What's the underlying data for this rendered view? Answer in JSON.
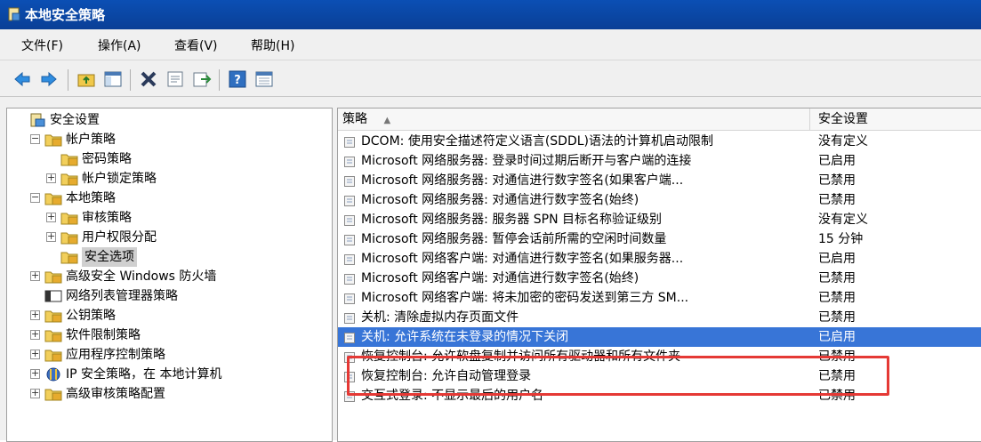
{
  "window": {
    "title": "本地安全策略"
  },
  "menu": [
    "文件(F)",
    "操作(A)",
    "查看(V)",
    "帮助(H)"
  ],
  "toolbar": {
    "buttons": [
      "back-icon",
      "forward-icon",
      "up-folder-icon",
      "show-hide-tree-icon",
      "delete-icon",
      "properties-icon",
      "export-list-icon",
      "help-icon",
      "mmc-icon"
    ]
  },
  "tree": {
    "items": [
      {
        "label": "安全设置",
        "level": 0,
        "expander": "",
        "icon": "security-settings-icon"
      },
      {
        "label": "帐户策略",
        "level": 1,
        "expander": "−",
        "icon": "folder-icon"
      },
      {
        "label": "密码策略",
        "level": 2,
        "expander": "",
        "icon": "folder-icon"
      },
      {
        "label": "帐户锁定策略",
        "level": 2,
        "expander": "+",
        "icon": "folder-icon"
      },
      {
        "label": "本地策略",
        "level": 1,
        "expander": "−",
        "icon": "folder-icon"
      },
      {
        "label": "审核策略",
        "level": 2,
        "expander": "+",
        "icon": "folder-icon"
      },
      {
        "label": "用户权限分配",
        "level": 2,
        "expander": "+",
        "icon": "folder-icon"
      },
      {
        "label": "安全选项",
        "level": 2,
        "expander": "",
        "icon": "folder-icon",
        "selected": true
      },
      {
        "label": "高级安全 Windows 防火墙",
        "level": 1,
        "expander": "+",
        "icon": "folder-icon"
      },
      {
        "label": "网络列表管理器策略",
        "level": 1,
        "expander": "",
        "icon": "network-list-icon"
      },
      {
        "label": "公钥策略",
        "level": 1,
        "expander": "+",
        "icon": "folder-icon"
      },
      {
        "label": "软件限制策略",
        "level": 1,
        "expander": "+",
        "icon": "folder-icon"
      },
      {
        "label": "应用程序控制策略",
        "level": 1,
        "expander": "+",
        "icon": "folder-icon"
      },
      {
        "label": "IP 安全策略，在 本地计算机",
        "level": 1,
        "expander": "+",
        "icon": "ip-security-icon"
      },
      {
        "label": "高级审核策略配置",
        "level": 1,
        "expander": "+",
        "icon": "folder-icon"
      }
    ]
  },
  "list": {
    "columns": {
      "policy": "策略",
      "sort_glyph": "▲",
      "setting": "安全设置"
    },
    "rows": [
      {
        "policy": "DCOM: 使用安全描述符定义语言(SDDL)语法的计算机启动限制",
        "setting": "没有定义"
      },
      {
        "policy": "Microsoft 网络服务器: 登录时间过期后断开与客户端的连接",
        "setting": "已启用"
      },
      {
        "policy": "Microsoft 网络服务器: 对通信进行数字签名(如果客户端...",
        "setting": "已禁用"
      },
      {
        "policy": "Microsoft 网络服务器: 对通信进行数字签名(始终)",
        "setting": "已禁用"
      },
      {
        "policy": "Microsoft 网络服务器: 服务器 SPN 目标名称验证级别",
        "setting": "没有定义"
      },
      {
        "policy": "Microsoft 网络服务器: 暂停会话前所需的空闲时间数量",
        "setting": "15 分钟"
      },
      {
        "policy": "Microsoft 网络客户端: 对通信进行数字签名(如果服务器...",
        "setting": "已启用"
      },
      {
        "policy": "Microsoft 网络客户端: 对通信进行数字签名(始终)",
        "setting": "已禁用"
      },
      {
        "policy": "Microsoft 网络客户端: 将未加密的密码发送到第三方 SM...",
        "setting": "已禁用"
      },
      {
        "policy": "关机: 清除虚拟内存页面文件",
        "setting": "已禁用"
      },
      {
        "policy": "关机: 允许系统在未登录的情况下关闭",
        "setting": "已启用",
        "selected": true
      },
      {
        "policy": "恢复控制台: 允许软盘复制并访问所有驱动器和所有文件夹",
        "setting": "已禁用"
      },
      {
        "policy": "恢复控制台: 允许自动管理登录",
        "setting": "已禁用"
      },
      {
        "policy": "交互式登录: 不显示最后的用户名",
        "setting": "已禁用"
      }
    ]
  },
  "colors": {
    "title_bar": "#0b4fb4",
    "selection": "#3875d7",
    "annotation_box": "#e53935"
  }
}
